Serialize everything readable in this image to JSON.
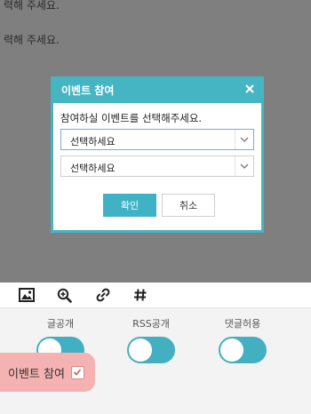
{
  "editor": {
    "line1": "력해 주세요.",
    "line2": "력해 주세요."
  },
  "toolbar": {
    "icons": [
      "image-icon",
      "zoom-icon",
      "link-icon",
      "hashtag-icon"
    ]
  },
  "options": [
    {
      "label": "글공개",
      "on": true
    },
    {
      "label": "RSS공개",
      "on": true
    },
    {
      "label": "댓글허용",
      "on": true
    }
  ],
  "event_participation": {
    "label": "이벤트 참여",
    "checked": true
  },
  "modal": {
    "title": "이벤트 참여",
    "prompt": "참여하실 이벤트를 선택해주세요.",
    "select1": "선택하세요",
    "select2": "선택하세요",
    "confirm_label": "확인",
    "cancel_label": "취소"
  },
  "colors": {
    "accent": "#45b5c4",
    "event_highlight": "#f5b2b2",
    "overlay": "rgba(0,0,0,0.5)"
  }
}
